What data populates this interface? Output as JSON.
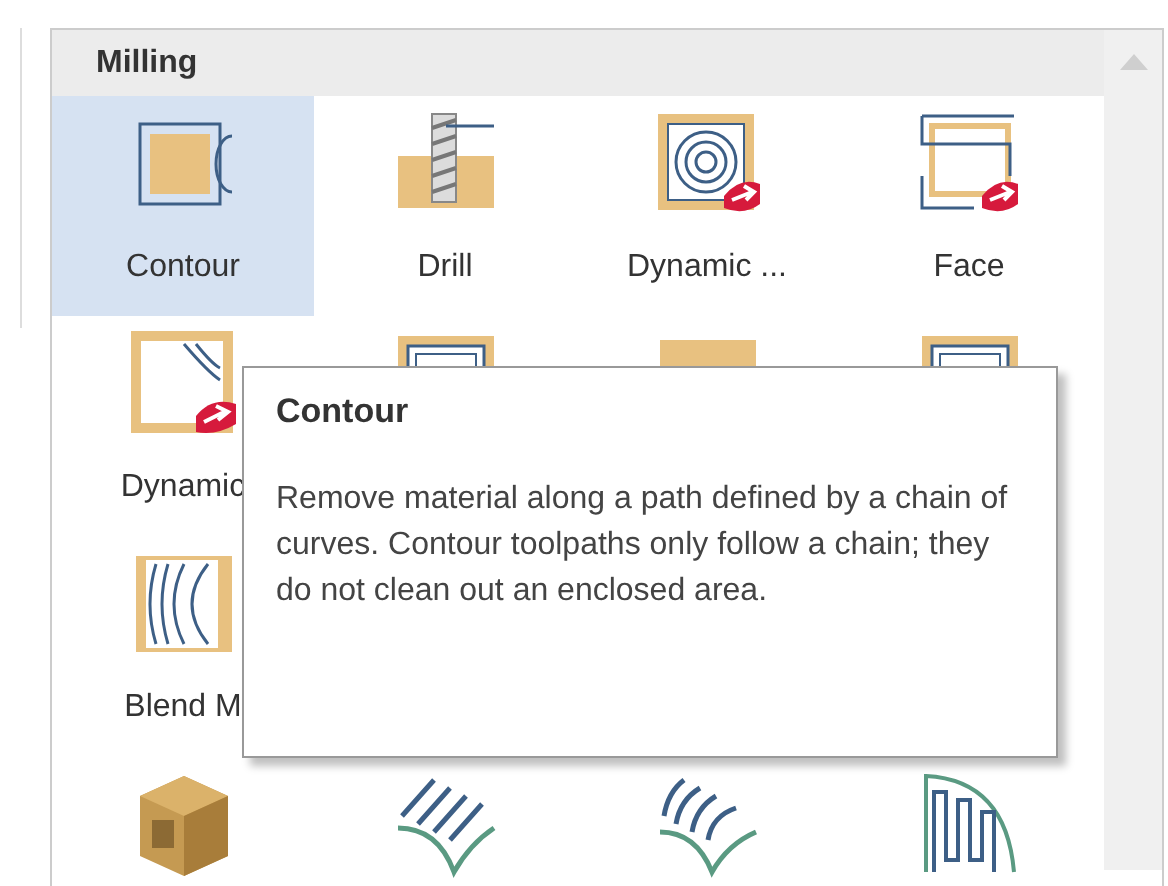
{
  "panel": {
    "title": "Milling"
  },
  "rows": [
    {
      "tiles": [
        {
          "kind": "contour",
          "label": "Contour",
          "selected": true
        },
        {
          "kind": "drill",
          "label": "Drill",
          "selected": false
        },
        {
          "kind": "dynamic-area",
          "label": "Dynamic ...",
          "selected": false
        },
        {
          "kind": "face",
          "label": "Face",
          "selected": false
        }
      ]
    },
    {
      "tiles": [
        {
          "kind": "dynamic-contour",
          "label": "Dynamic",
          "selected": false
        },
        {
          "kind": "pocket",
          "selected": false
        },
        {
          "kind": "block",
          "selected": false
        },
        {
          "kind": "frame",
          "selected": false
        }
      ]
    },
    {
      "tiles": [
        {
          "kind": "blend",
          "label": "Blend M",
          "selected": false
        }
      ]
    },
    {
      "tiles": [
        {
          "kind": "solid",
          "selected": false
        },
        {
          "kind": "parallel",
          "selected": false
        },
        {
          "kind": "curved",
          "selected": false
        },
        {
          "kind": "zigzag",
          "selected": false
        }
      ]
    }
  ],
  "tooltip": {
    "title": "Contour",
    "text": "Remove material along a path defined by a chain of curves. Contour toolpaths only follow a chain; they do not clean out an enclosed area."
  }
}
